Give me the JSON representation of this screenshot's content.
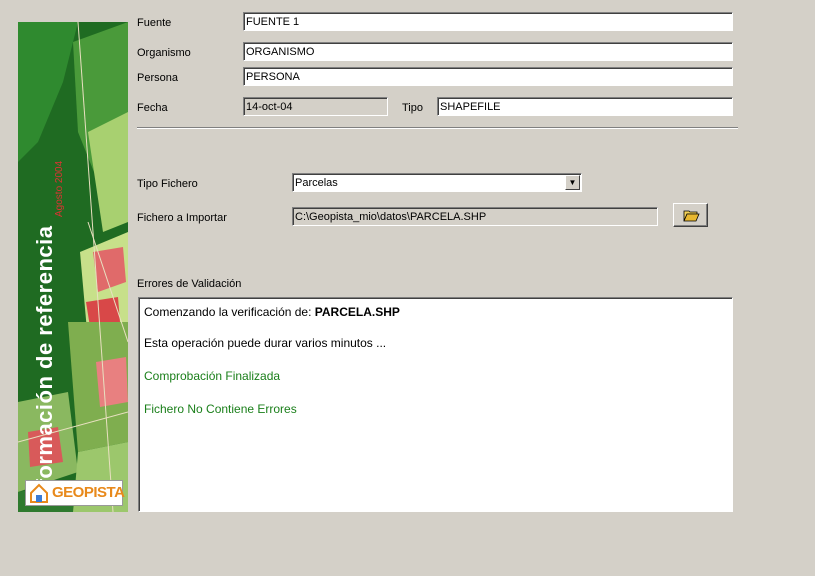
{
  "sidebar": {
    "title": "Información de referencia",
    "subtitle": "Agosto 2004",
    "logo_text": "GEOPISTA"
  },
  "form": {
    "fuente_label": "Fuente",
    "fuente_value": "FUENTE 1",
    "organismo_label": "Organismo",
    "organismo_value": "ORGANISMO",
    "persona_label": "Persona",
    "persona_value": "PERSONA",
    "fecha_label": "Fecha",
    "fecha_value": "14-oct-04",
    "tipo_label": "Tipo",
    "tipo_value": "SHAPEFILE",
    "tipo_fichero_label": "Tipo Fichero",
    "tipo_fichero_value": "Parcelas",
    "fichero_label": "Fichero a Importar",
    "fichero_value": "C:\\Geopista_mio\\datos\\PARCELA.SHP"
  },
  "validation": {
    "label": "Errores de Validación",
    "line1_prefix": "Comenzando la verificación de: ",
    "line1_file": "PARCELA.SHP",
    "line2": "Esta operación puede durar varios minutos ...",
    "line3": "Comprobación Finalizada",
    "line4": "Fichero No Contiene Errores"
  },
  "icons": {
    "open_folder": "folder-open-icon",
    "dropdown": "chevron-down-icon",
    "logo": "geopista-logo"
  }
}
